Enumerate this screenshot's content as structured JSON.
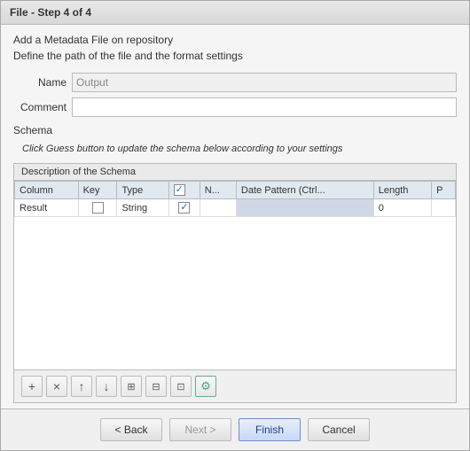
{
  "window": {
    "title": "File - Step 4 of 4",
    "subtitle_line1": "Add a Metadata File on repository",
    "subtitle_line2": "Define the path of the file and the format settings"
  },
  "form": {
    "name_label": "Name",
    "name_value": "Output",
    "comment_label": "Comment",
    "comment_value": "",
    "schema_label": "Schema",
    "guess_hint": "Click Guess button to update the schema below according to your settings"
  },
  "schema": {
    "title": "Description of the Schema",
    "columns": [
      "Column",
      "Key",
      "Type",
      "N...",
      "Date Pattern (Ctrl...",
      "Length",
      "P"
    ],
    "rows": [
      {
        "column": "Result",
        "key": false,
        "type": "String",
        "nullable": true,
        "date_pattern": "",
        "length": "0",
        "precision": ""
      }
    ]
  },
  "toolbar": {
    "buttons": [
      {
        "icon": "+",
        "name": "add"
      },
      {
        "icon": "×",
        "name": "delete"
      },
      {
        "icon": "↑",
        "name": "move-up"
      },
      {
        "icon": "↓",
        "name": "move-down"
      },
      {
        "icon": "⊞",
        "name": "copy"
      },
      {
        "icon": "⊟",
        "name": "paste"
      },
      {
        "icon": "⊡",
        "name": "duplicate"
      },
      {
        "icon": "⚙",
        "name": "settings"
      }
    ]
  },
  "footer": {
    "back_label": "< Back",
    "next_label": "Next >",
    "finish_label": "Finish",
    "cancel_label": "Cancel"
  }
}
